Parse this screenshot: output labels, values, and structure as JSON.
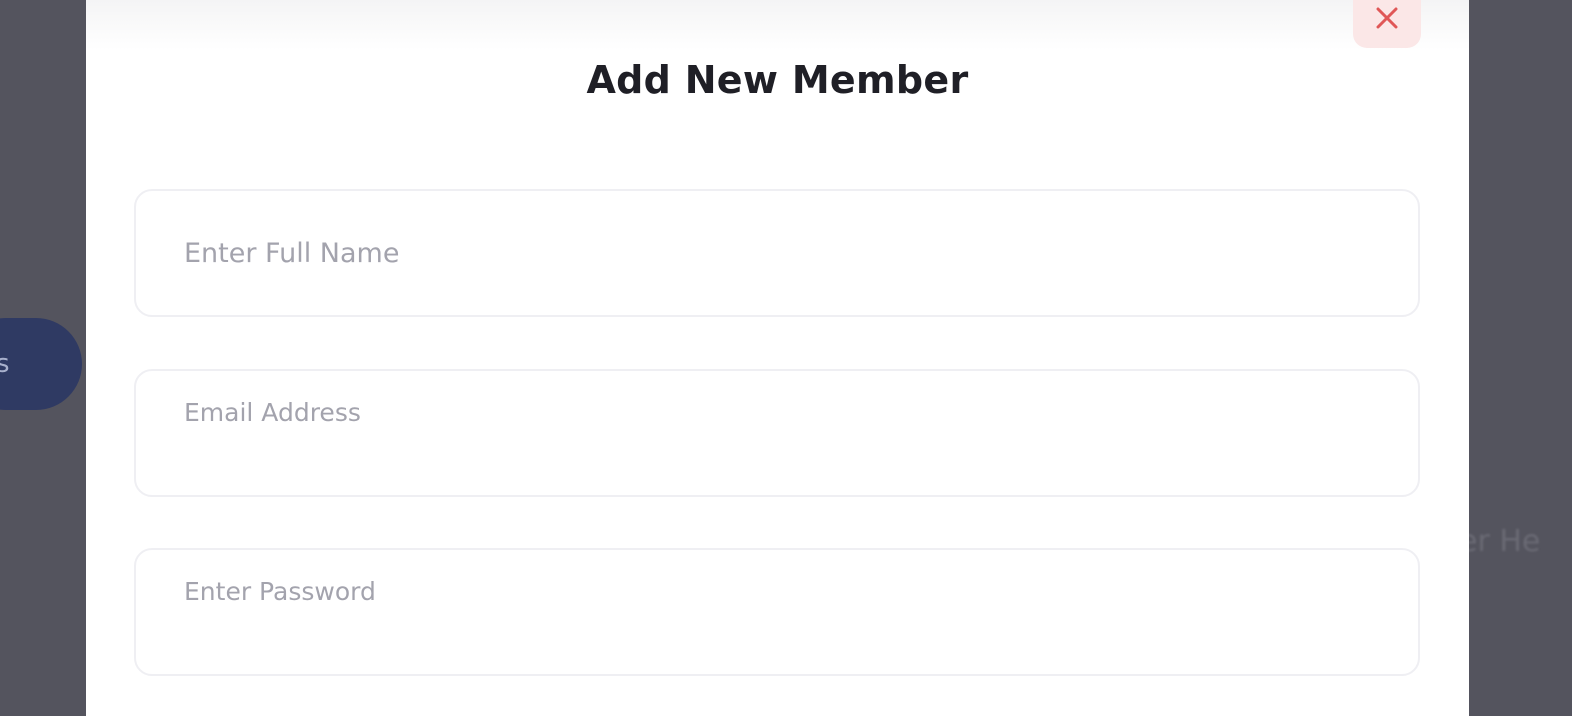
{
  "background": {
    "left_button_label": "s",
    "right_text": "ber He"
  },
  "modal": {
    "title": "Add New Member",
    "close_icon": "close-icon",
    "fields": {
      "full_name": {
        "placeholder": "Enter Full Name",
        "value": ""
      },
      "email": {
        "placeholder": "Email Address",
        "value": ""
      },
      "password": {
        "placeholder": "Enter Password",
        "value": ""
      }
    }
  },
  "colors": {
    "overlay": "#54545e",
    "close_bg": "#fbe7e7",
    "close_icon": "#e05757",
    "title": "#1f1f26",
    "placeholder": "#a3a3ad",
    "field_border": "#efeff3"
  }
}
